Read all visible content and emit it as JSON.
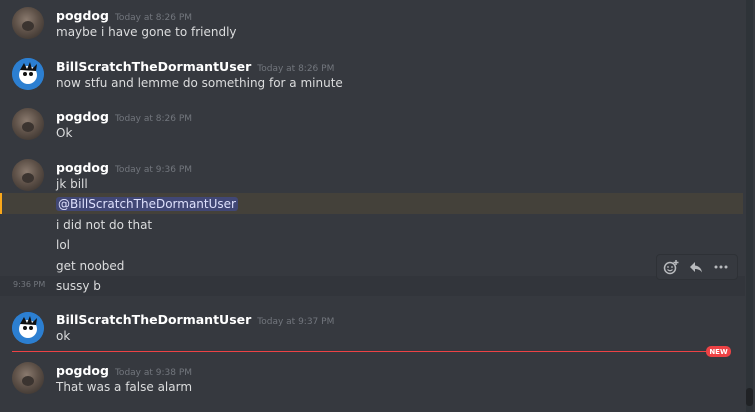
{
  "messages": [
    {
      "author": "pogdog",
      "timestamp": "Today at 8:26 PM",
      "lines": [
        "maybe i have gone to friendly"
      ]
    },
    {
      "author": "BillScratchTheDormantUser",
      "timestamp": "Today at 8:26 PM",
      "lines": [
        "now stfu and lemme do something for a minute"
      ]
    },
    {
      "author": "pogdog",
      "timestamp": "Today at 8:26 PM",
      "lines": [
        "Ok"
      ]
    },
    {
      "author": "pogdog",
      "timestamp": "Today at 9:36 PM",
      "lines": [
        "jk bill",
        "@BillScratchTheDormantUser",
        "i did not do that",
        "lol",
        "get noobed",
        "sussy b"
      ]
    },
    {
      "author": "BillScratchTheDormantUser",
      "timestamp": "Today at 9:37 PM",
      "lines": [
        "ok"
      ]
    },
    {
      "author": "pogdog",
      "timestamp": "Today at 9:38 PM",
      "lines": [
        "That was a false alarm"
      ]
    }
  ],
  "hover_timestamp": "9:36 PM",
  "new_divider_label": "NEW",
  "toolbar": {
    "icons": [
      "add-reaction-icon",
      "reply-icon",
      "more-icon"
    ]
  },
  "colors": {
    "background": "#36393f",
    "mention_highlight": "#44413a",
    "mention_bar": "#faa81a",
    "new_divider": "#ed4245"
  }
}
